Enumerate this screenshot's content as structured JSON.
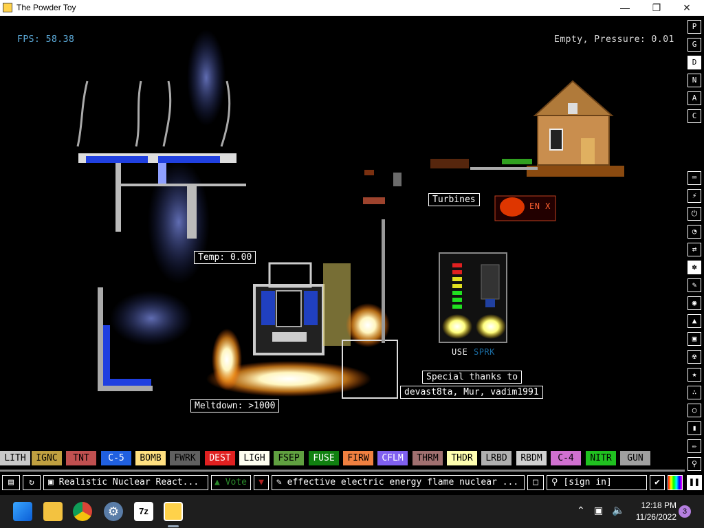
{
  "window": {
    "title": "The Powder Toy",
    "controls": [
      "minimize-icon",
      "maximize-icon",
      "close-icon"
    ]
  },
  "hud": {
    "fps": "FPS: 58.38",
    "status": "Empty, Pressure: 0.01"
  },
  "canvas_labels": {
    "turbines": "Turbines",
    "temp": "Temp: 0.00",
    "meltdown": "Meltdown: >1000",
    "thanks_1": "Special thanks to",
    "thanks_2": "devast8ta, Mur, vadim1991",
    "use": "USE",
    "sprk": "SPRK",
    "sign": "EN X"
  },
  "display_modes": [
    "P",
    "G",
    "D",
    "N",
    "A",
    "C"
  ],
  "active_display_mode": "D",
  "tool_icons": [
    "keyboard-icon",
    "plug-icon",
    "power-icon",
    "gauge-icon",
    "arrows-icon",
    "spray-icon",
    "brush-icon",
    "drop-icon",
    "flask-icon",
    "box-icon",
    "radiation-icon",
    "star-icon",
    "dots-icon",
    "bulb-icon",
    "bookmark-icon",
    "pen-icon",
    "search-icon"
  ],
  "elements": [
    {
      "label": "LITH",
      "bg": "#c8c8c8",
      "fg": "#000000"
    },
    {
      "label": "IGNC",
      "bg": "#c0a040",
      "fg": "#000000"
    },
    {
      "label": "TNT",
      "bg": "#c05050",
      "fg": "#000000"
    },
    {
      "label": "C-5",
      "bg": "#2060e0",
      "fg": "#ffffff"
    },
    {
      "label": "BOMB",
      "bg": "#ffe080",
      "fg": "#000000"
    },
    {
      "label": "FWRK",
      "bg": "#606060",
      "fg": "#000000"
    },
    {
      "label": "DEST",
      "bg": "#e02020",
      "fg": "#ffffff"
    },
    {
      "label": "LIGH",
      "bg": "#fffff0",
      "fg": "#000000"
    },
    {
      "label": "FSEP",
      "bg": "#60a040",
      "fg": "#000000"
    },
    {
      "label": "FUSE",
      "bg": "#108010",
      "fg": "#ffffff"
    },
    {
      "label": "FIRW",
      "bg": "#f08040",
      "fg": "#000000"
    },
    {
      "label": "CFLM",
      "bg": "#8060f0",
      "fg": "#ffffff"
    },
    {
      "label": "THRM",
      "bg": "#a07070",
      "fg": "#000000"
    },
    {
      "label": "THDR",
      "bg": "#ffffb0",
      "fg": "#000000"
    },
    {
      "label": "LRBD",
      "bg": "#b0b0b0",
      "fg": "#000000"
    },
    {
      "label": "RBDM",
      "bg": "#d0d0d0",
      "fg": "#000000"
    },
    {
      "label": "C-4",
      "bg": "#d070d0",
      "fg": "#000000"
    },
    {
      "label": "NITR",
      "bg": "#20c020",
      "fg": "#000000"
    },
    {
      "label": "GUN",
      "bg": "#a0a0a0",
      "fg": "#000000"
    }
  ],
  "bottom_bar": {
    "save_title": "Realistic Nuclear React...",
    "vote": "Vote",
    "tags": "effective electric energy flame nuclear ...",
    "sign_in": "[sign in]"
  },
  "taskbar": {
    "time": "12:18 PM",
    "date": "11/26/2022",
    "notifications": "3"
  }
}
